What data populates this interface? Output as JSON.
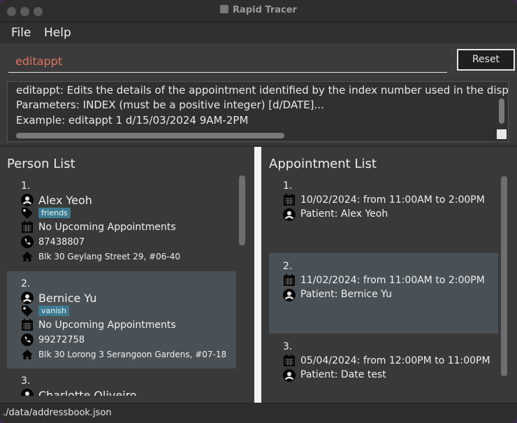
{
  "window": {
    "title": "Rapid Tracer"
  },
  "menu": {
    "file": "File",
    "help": "Help"
  },
  "command": {
    "value": "editappt",
    "reset_label": "Reset"
  },
  "result": {
    "lines": [
      "editappt: Edits the details of the appointment identified by the index number used in the displaye",
      "Parameters: INDEX (must be a positive integer) [d/DATE]...",
      "Example: editappt 1 d/15/03/2024 9AM-2PM"
    ]
  },
  "person_list": {
    "heading": "Person List",
    "persons": [
      {
        "index": "1.",
        "name": "Alex Yeoh",
        "tag": "friends",
        "appointment": "No Upcoming Appointments",
        "phone": "87438807",
        "address": "Blk 30 Geylang Street 29, #06-40"
      },
      {
        "index": "2.",
        "name": "Bernice Yu",
        "tag": "vanish",
        "appointment": "No Upcoming Appointments",
        "phone": "99272758",
        "address": "Blk 30 Lorong 3 Serangoon Gardens, #07-18"
      },
      {
        "index": "3.",
        "name": "Charlotte Oliveiro"
      }
    ]
  },
  "appointment_list": {
    "heading": "Appointment List",
    "appointments": [
      {
        "index": "1.",
        "datetime": "10/02/2024: from 11:00AM to 2:00PM",
        "patient": "Patient: Alex Yeoh"
      },
      {
        "index": "2.",
        "datetime": "11/02/2024: from 11:00AM to 2:00PM",
        "patient": "Patient: Bernice Yu"
      },
      {
        "index": "3.",
        "datetime": "05/04/2024: from 12:00PM to 11:00PM",
        "patient": "Patient: Date test"
      }
    ]
  },
  "status_bar": {
    "path": "./data/addressbook.json"
  },
  "colors": {
    "command_text": "#e0725f",
    "tag": "#3e7b91",
    "selected_card": "#4a5156",
    "divider": "#f4f4f4"
  },
  "icons": [
    "person-icon",
    "tag-icon",
    "calendar-icon",
    "phone-icon",
    "home-icon"
  ]
}
